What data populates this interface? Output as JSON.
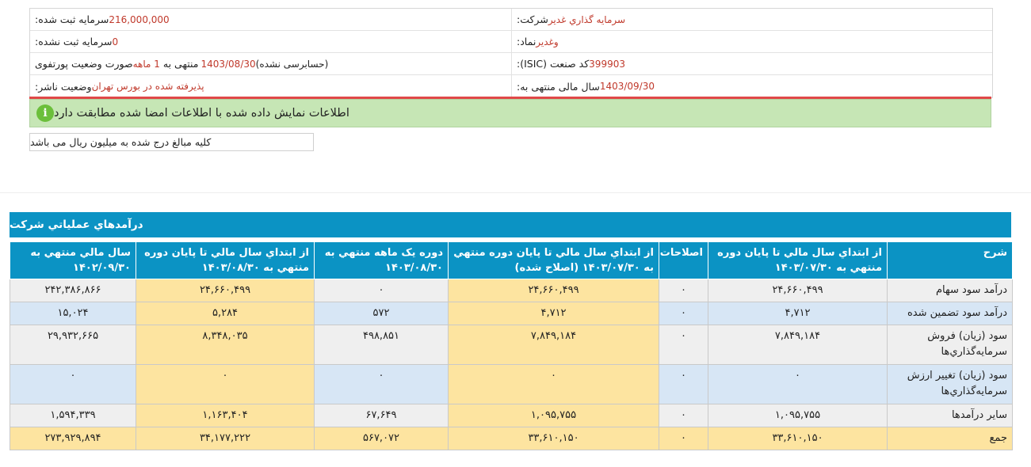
{
  "info": {
    "company_label": "شرکت:",
    "company_value": "سرمايه گذاري غدير",
    "symbol_label": "نماد:",
    "symbol_value": "وغدير",
    "isic_label": "کد صنعت (ISIC):",
    "isic_value": "399903",
    "fiscal_label": "سال مالی منتهی به:",
    "fiscal_value": "1403/09/30",
    "capital_label": "سرمایه ثبت شده:",
    "capital_value": "216,000,000",
    "unreg_capital_label": "سرمایه ثبت نشده:",
    "unreg_capital_value": "0",
    "report_label": "صورت وضعیت پورتفوی",
    "report_value": "1 ماهه",
    "report_suffix": "منتهی به",
    "report_date": "1403/08/30",
    "report_audit": "(حسابرسی نشده)",
    "publisher_label": "وضعیت ناشر:",
    "publisher_value": "پذیرفته شده در بورس تهران"
  },
  "alert": {
    "icon": "info-icon",
    "text": "اطلاعات نمایش داده شده با اطلاعات امضا شده مطابقت دارد"
  },
  "unit_note": "کلیه مبالغ درج شده به میلیون ریال می باشد",
  "section_title": "درآمدهاي عملياتي شرکت",
  "table": {
    "headers": [
      "شرح",
      "از ابتداي سال مالي تا پايان دوره منتهي به ۱۴۰۳/۰۷/۳۰",
      "اصلاحات",
      "از ابتداي سال مالي تا پايان دوره منتهي به ۱۴۰۳/۰۷/۳۰ (اصلاح شده)",
      "دوره يک ماهه منتهي به ۱۴۰۳/۰۸/۳۰",
      "از ابتداي سال مالي تا پايان دوره منتهي به ۱۴۰۳/۰۸/۳۰",
      "سال مالي منتهي به ۱۴۰۲/۰۹/۳۰"
    ],
    "rows": [
      {
        "label": "درآمد سود سهام",
        "values": [
          "۲۴,۶۶۰,۴۹۹",
          "۰",
          "۲۴,۶۶۰,۴۹۹",
          "۰",
          "۲۴,۶۶۰,۴۹۹",
          "۲۴۲,۳۸۶,۸۶۶"
        ]
      },
      {
        "label": "درآمد سود تضمين شده",
        "values": [
          "۴,۷۱۲",
          "۰",
          "۴,۷۱۲",
          "۵۷۲",
          "۵,۲۸۴",
          "۱۵,۰۲۴"
        ]
      },
      {
        "label": "سود (زيان) فروش سرمايه‌گذاري‌ها",
        "values": [
          "۷,۸۴۹,۱۸۴",
          "۰",
          "۷,۸۴۹,۱۸۴",
          "۴۹۸,۸۵۱",
          "۸,۳۴۸,۰۳۵",
          "۲۹,۹۳۲,۶۶۵"
        ]
      },
      {
        "label": "سود (زيان) تغيير ارزش سرمايه‌گذاري‌ها",
        "values": [
          "۰",
          "۰",
          "۰",
          "۰",
          "۰",
          "۰"
        ]
      },
      {
        "label": "ساير درآمدها",
        "values": [
          "۱,۰۹۵,۷۵۵",
          "۰",
          "۱,۰۹۵,۷۵۵",
          "۶۷,۶۴۹",
          "۱,۱۶۳,۴۰۴",
          "۱,۵۹۴,۳۳۹"
        ]
      },
      {
        "label": "جمع",
        "values": [
          "۳۳,۶۱۰,۱۵۰",
          "۰",
          "۳۳,۶۱۰,۱۵۰",
          "۵۶۷,۰۷۲",
          "۳۴,۱۷۷,۲۲۲",
          "۲۷۳,۹۲۹,۸۹۴"
        ]
      }
    ]
  },
  "colors": {
    "header_bg": "#0b93c4",
    "highlight": "#fde4a0",
    "alert_bg": "#c6e6b5",
    "value_red": "#c0392b"
  }
}
